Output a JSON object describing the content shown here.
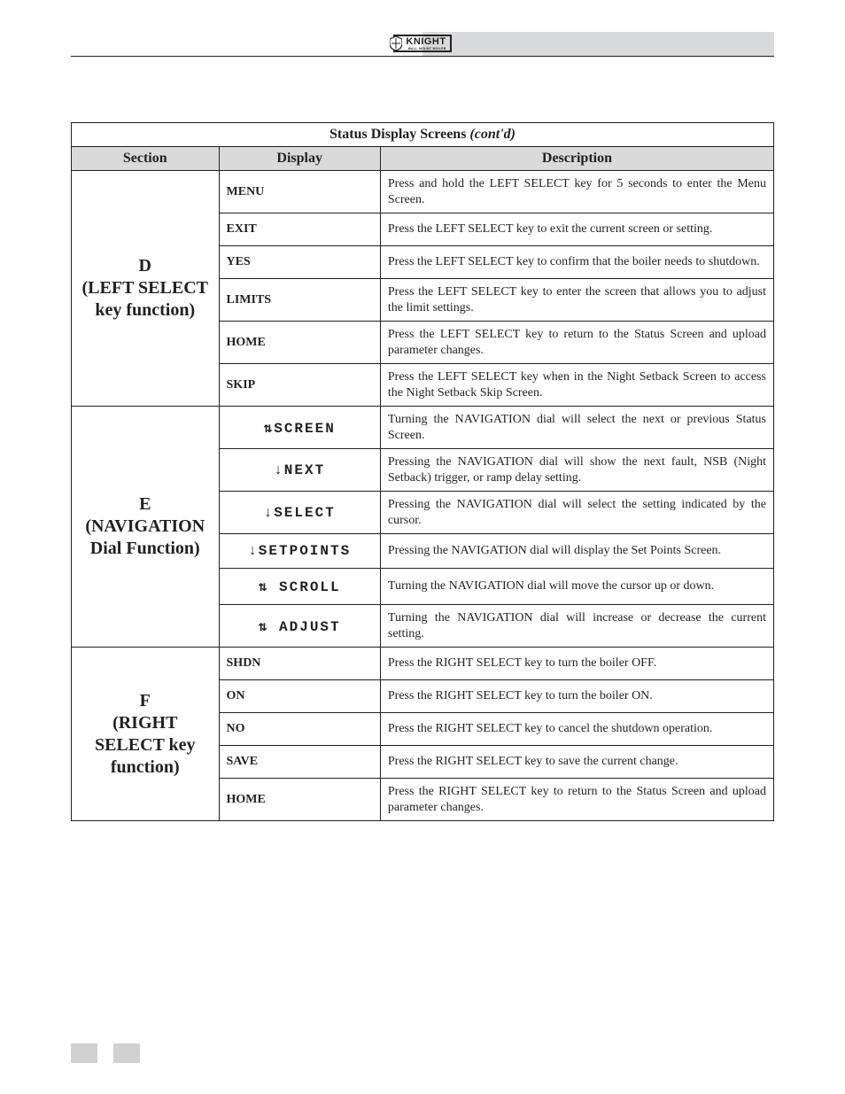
{
  "logo": {
    "brand": "KNIGHT",
    "sub": "WALL MOUNT BOILER"
  },
  "table": {
    "title": "Status Display Screens",
    "title_suffix": "(cont'd)",
    "headers": {
      "section": "Section",
      "display": "Display",
      "description": "Description"
    },
    "groups": [
      {
        "section": "D\n(LEFT SELECT key function)",
        "rows": [
          {
            "display": "MENU",
            "mono": false,
            "desc": "Press and hold the LEFT SELECT key for 5 seconds to enter the Menu Screen."
          },
          {
            "display": "EXIT",
            "mono": false,
            "desc": "Press the LEFT SELECT key to exit the current screen or setting."
          },
          {
            "display": "YES",
            "mono": false,
            "desc": "Press the LEFT SELECT key to confirm that the boiler needs to shutdown."
          },
          {
            "display": "LIMITS",
            "mono": false,
            "desc": "Press the LEFT SELECT key to enter the screen that allows you to adjust the limit settings."
          },
          {
            "display": "HOME",
            "mono": false,
            "desc": "Press the LEFT SELECT key to return to the Status Screen and upload parameter changes."
          },
          {
            "display": "SKIP",
            "mono": false,
            "desc": "Press the LEFT SELECT key when in the Night Setback Screen to access the Night Setback Skip Screen."
          }
        ]
      },
      {
        "section": "E\n(NAVIGATION Dial Function)",
        "rows": [
          {
            "display": "⇅SCREEN",
            "mono": true,
            "desc": "Turning the NAVIGATION dial will select the next or previous Status Screen."
          },
          {
            "display": "↓NEXT",
            "mono": true,
            "desc": "Pressing the NAVIGATION dial will show the next fault, NSB (Night Setback) trigger, or ramp delay setting."
          },
          {
            "display": "↓SELECT",
            "mono": true,
            "desc": "Pressing the NAVIGATION dial will select the setting indicated by the cursor."
          },
          {
            "display": "↓SETPOINTS",
            "mono": true,
            "desc": "Pressing the NAVIGATION dial will display the Set Points Screen."
          },
          {
            "display": "⇅ SCROLL",
            "mono": true,
            "desc": "Turning the NAVIGATION dial will move the cursor up or down."
          },
          {
            "display": "⇅ ADJUST",
            "mono": true,
            "desc": "Turning the NAVIGATION dial will increase or decrease the current setting."
          }
        ]
      },
      {
        "section": "F\n(RIGHT SELECT key function)",
        "rows": [
          {
            "display": "SHDN",
            "mono": false,
            "desc": "Press the RIGHT SELECT key to turn the boiler OFF."
          },
          {
            "display": "ON",
            "mono": false,
            "desc": "Press the RIGHT SELECT key to turn the boiler ON."
          },
          {
            "display": "NO",
            "mono": false,
            "desc": "Press the RIGHT SELECT key to cancel the shutdown operation."
          },
          {
            "display": "SAVE",
            "mono": false,
            "desc": "Press the RIGHT SELECT key to save the current change."
          },
          {
            "display": "HOME",
            "mono": false,
            "desc": "Press the RIGHT SELECT key to return to the Status Screen and upload parameter changes."
          }
        ]
      }
    ]
  }
}
